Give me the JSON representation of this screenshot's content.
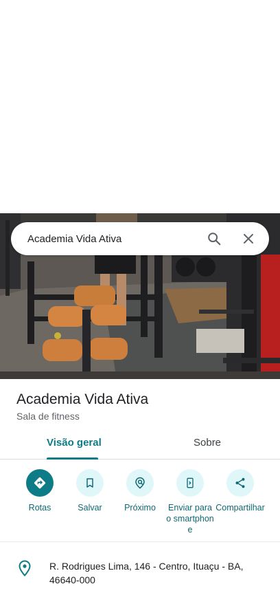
{
  "search": {
    "query": "Academia Vida Ativa"
  },
  "place": {
    "name": "Academia Vida Ativa",
    "category": "Sala de fitness",
    "address": "R. Rodrigues Lima, 146 - Centro, Ituaçu - BA, 46640-000"
  },
  "tabs": [
    {
      "label": "Visão geral",
      "active": true
    },
    {
      "label": "Sobre",
      "active": false
    }
  ],
  "actions": [
    {
      "label": "Rotas",
      "icon": "directions-icon"
    },
    {
      "label": "Salvar",
      "icon": "bookmark-icon"
    },
    {
      "label": "Próximo",
      "icon": "nearby-icon"
    },
    {
      "label": "Enviar para o smartphone",
      "icon": "send-to-phone-icon"
    },
    {
      "label": "Compartilhar",
      "icon": "share-icon"
    }
  ],
  "colors": {
    "accent": "#0e7c86",
    "action_bg": "#e0f7fa",
    "text_primary": "#202124",
    "text_secondary": "#5f6368"
  }
}
